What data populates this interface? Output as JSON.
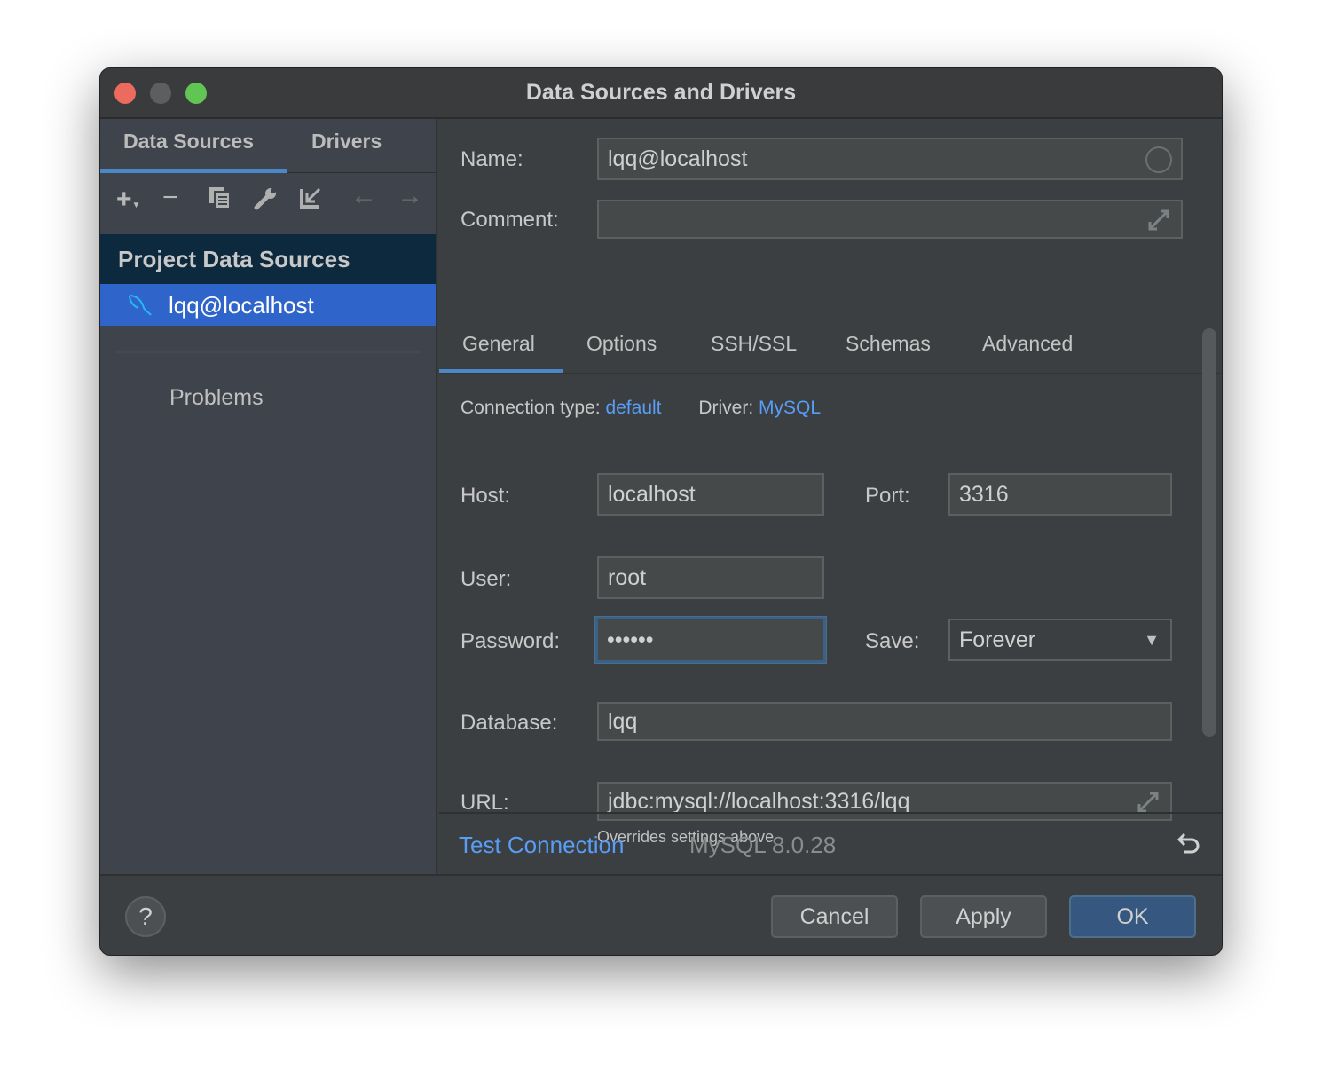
{
  "window": {
    "title": "Data Sources and Drivers"
  },
  "left": {
    "tabs": [
      "Data Sources",
      "Drivers"
    ],
    "group": "Project Data Sources",
    "selected_item": "lqq@localhost",
    "problems": "Problems"
  },
  "form": {
    "name_label": "Name:",
    "name_value": "lqq@localhost",
    "comment_label": "Comment:",
    "comment_value": "",
    "tabs": [
      "General",
      "Options",
      "SSH/SSL",
      "Schemas",
      "Advanced"
    ],
    "connection_type_label": "Connection type:",
    "connection_type": "default",
    "driver_label": "Driver:",
    "driver": "MySQL",
    "host_label": "Host:",
    "host": "localhost",
    "port_label": "Port:",
    "port": "3316",
    "user_label": "User:",
    "user": "root",
    "password_label": "Password:",
    "password": "••••••",
    "save_label": "Save:",
    "save": "Forever",
    "database_label": "Database:",
    "database": "lqq",
    "url_label": "URL:",
    "url": "jdbc:mysql://localhost:3316/lqq",
    "url_hint": "Overrides settings above"
  },
  "footer": {
    "test_connection": "Test Connection",
    "version": "MySQL 8.0.28"
  },
  "buttons": {
    "help": "?",
    "cancel": "Cancel",
    "apply": "Apply",
    "ok": "OK"
  },
  "colors": {
    "accent": "#589df6",
    "selection": "#2f65ca",
    "ok": "#365880"
  }
}
